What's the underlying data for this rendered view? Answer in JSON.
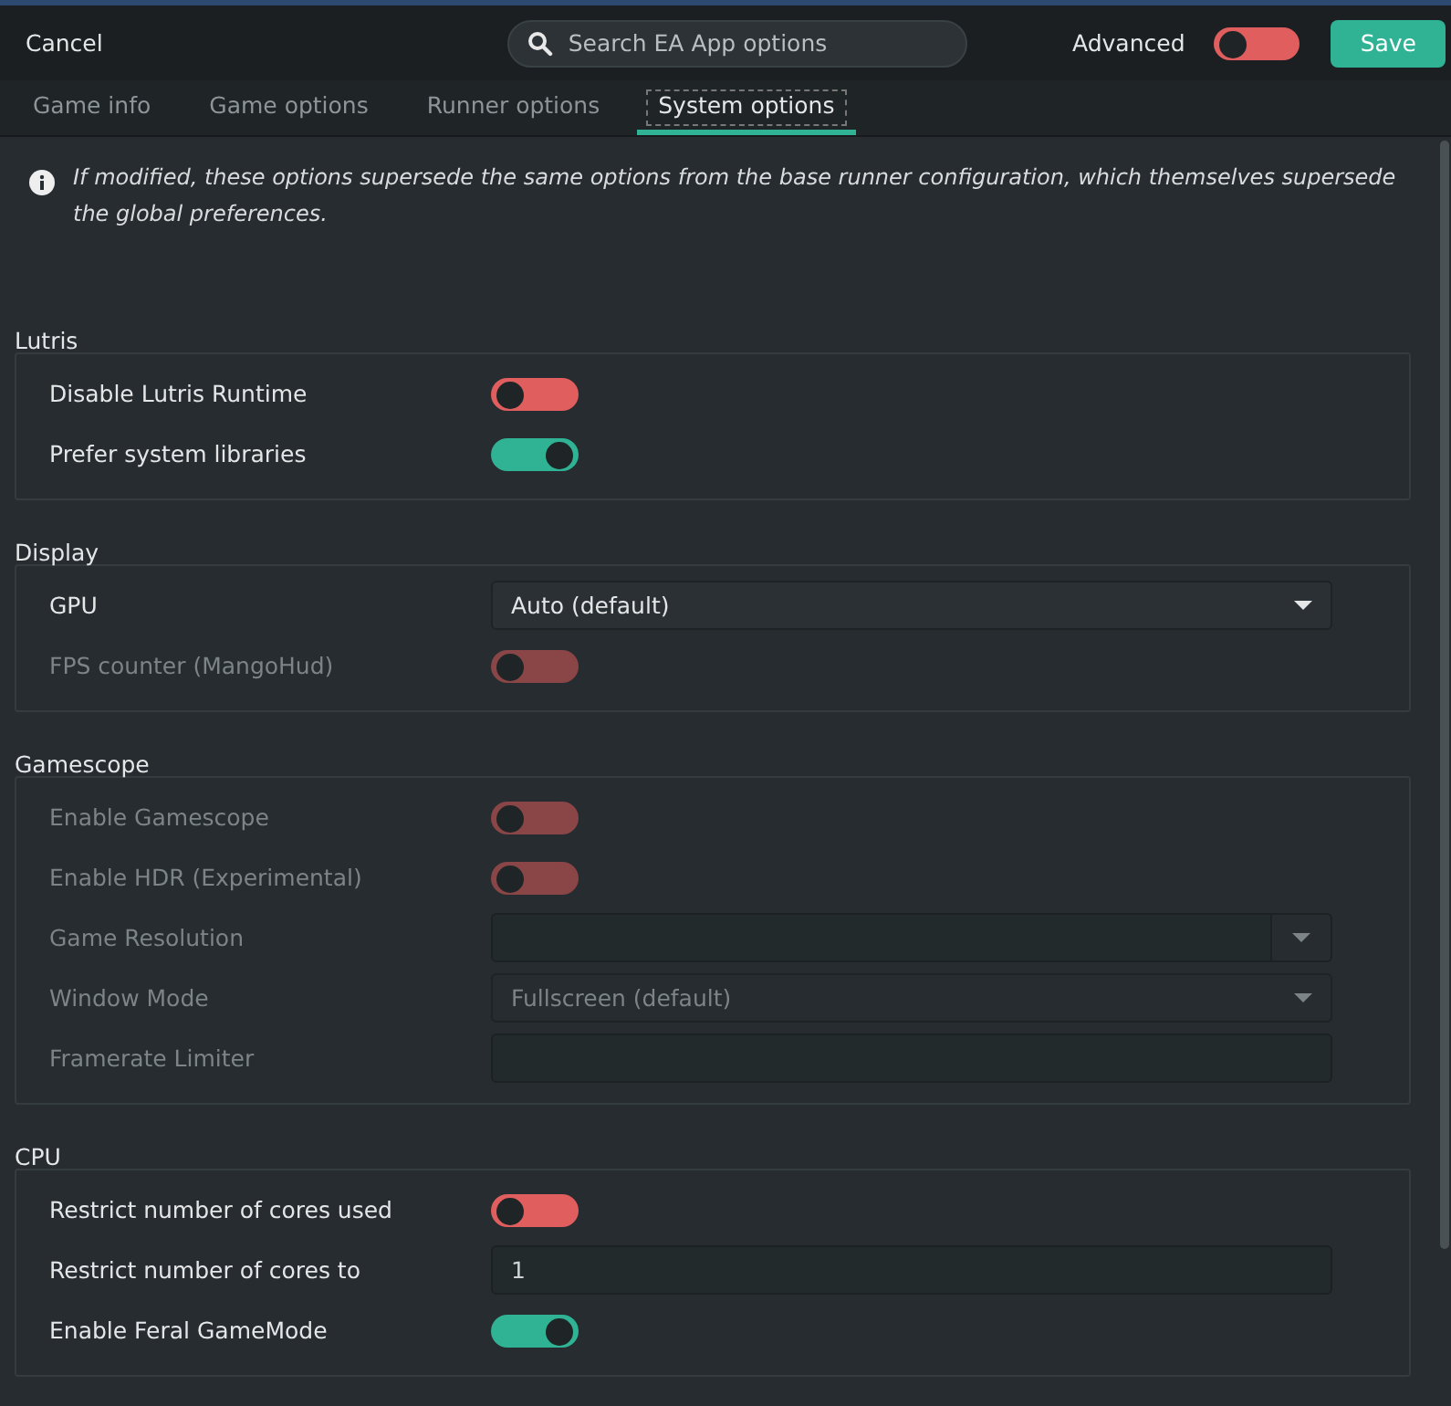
{
  "header": {
    "cancel": "Cancel",
    "search": {
      "placeholder": "Search EA App options"
    },
    "advanced": {
      "label": "Advanced",
      "on": false
    },
    "save": "Save"
  },
  "tabs": [
    {
      "label": "Game info",
      "selected": false
    },
    {
      "label": "Game options",
      "selected": false
    },
    {
      "label": "Runner options",
      "selected": false
    },
    {
      "label": "System options",
      "selected": true
    }
  ],
  "info": "If modified, these options supersede the same options from the base runner configuration, which themselves supersede the global preferences.",
  "sections": [
    {
      "title": "Lutris",
      "rows": [
        {
          "kind": "switch",
          "label": "Disable Lutris Runtime",
          "on": false,
          "disabled": false
        },
        {
          "kind": "switch",
          "label": "Prefer system libraries",
          "on": true,
          "disabled": false
        }
      ]
    },
    {
      "title": "Display",
      "rows": [
        {
          "kind": "dropdown",
          "label": "GPU",
          "value": "Auto (default)",
          "disabled": false
        },
        {
          "kind": "switch",
          "label": "FPS counter (MangoHud)",
          "on": false,
          "disabled": true
        }
      ]
    },
    {
      "title": "Gamescope",
      "rows": [
        {
          "kind": "switch",
          "label": "Enable Gamescope",
          "on": false,
          "disabled": true
        },
        {
          "kind": "switch",
          "label": "Enable HDR (Experimental)",
          "on": false,
          "disabled": true
        },
        {
          "kind": "combo-entry",
          "label": "Game Resolution",
          "disabled": true
        },
        {
          "kind": "dropdown",
          "label": "Window Mode",
          "value": "Fullscreen (default)",
          "disabled": true
        },
        {
          "kind": "entry",
          "label": "Framerate Limiter",
          "disabled": true
        }
      ]
    },
    {
      "title": "CPU",
      "rows": [
        {
          "kind": "switch",
          "label": "Restrict number of cores used",
          "on": false,
          "disabled": false
        },
        {
          "kind": "entry",
          "label": "Restrict number of cores to",
          "value": "1",
          "disabled": false
        },
        {
          "kind": "switch",
          "label": "Enable Feral GameMode",
          "on": true,
          "disabled": false
        }
      ]
    }
  ]
}
